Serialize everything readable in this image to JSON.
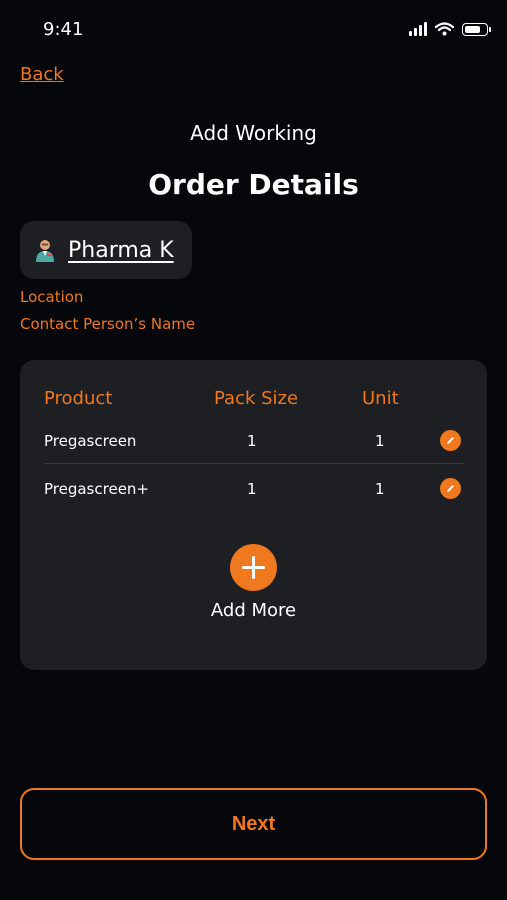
{
  "status_bar": {
    "time": "9:41"
  },
  "nav": {
    "back_label": "Back"
  },
  "header": {
    "subtitle": "Add Working",
    "title": "Order Details"
  },
  "pharmacy": {
    "name": "Pharma K",
    "avatar_icon": "pharmacist-avatar-icon"
  },
  "details": {
    "location_label": "Location",
    "contact_label": "Contact Person’s Name"
  },
  "table": {
    "headers": {
      "product": "Product",
      "pack_size": "Pack Size",
      "unit": "Unit"
    },
    "rows": [
      {
        "product": "Pregascreen",
        "pack_size": "1",
        "unit": "1"
      },
      {
        "product": "Pregascreen+",
        "pack_size": "1",
        "unit": "1"
      }
    ]
  },
  "add_more": {
    "label": "Add More"
  },
  "footer": {
    "next_label": "Next"
  },
  "colors": {
    "accent": "#f0781e",
    "background": "#05070b",
    "card": "#1d1f22"
  }
}
